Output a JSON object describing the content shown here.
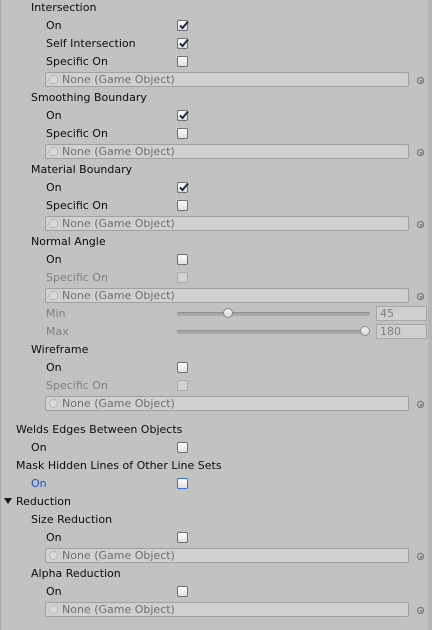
{
  "intersection": {
    "header": "Intersection",
    "on_label": "On",
    "self_label": "Self Intersection",
    "specific_label": "Specific On",
    "field_value": "None (Game Object)",
    "on_checked": true,
    "self_checked": true,
    "specific_checked": false
  },
  "smoothing": {
    "header": "Smoothing Boundary",
    "on_label": "On",
    "specific_label": "Specific On",
    "field_value": "None (Game Object)",
    "on_checked": true,
    "specific_checked": false
  },
  "material": {
    "header": "Material Boundary",
    "on_label": "On",
    "specific_label": "Specific On",
    "field_value": "None (Game Object)",
    "on_checked": true,
    "specific_checked": false
  },
  "normal_angle": {
    "header": "Normal Angle",
    "on_label": "On",
    "specific_label": "Specific On",
    "field_value": "None (Game Object)",
    "min_label": "Min",
    "min_value": "45",
    "max_label": "Max",
    "max_value": "180",
    "on_checked": false,
    "specific_checked": false,
    "min_slider_fraction": 0.25,
    "max_slider_fraction": 1.0
  },
  "wireframe": {
    "header": "Wireframe",
    "on_label": "On",
    "specific_label": "Specific On",
    "field_value": "None (Game Object)",
    "on_checked": false,
    "specific_checked": false
  },
  "welds": {
    "header": "Welds Edges Between Objects",
    "on_label": "On",
    "on_checked": false
  },
  "mask_hidden": {
    "header": "Mask Hidden Lines of Other Line Sets",
    "on_label": "On",
    "on_checked": false
  },
  "reduction": {
    "header": "Reduction",
    "expanded": true,
    "size": {
      "header": "Size Reduction",
      "on_label": "On",
      "field_value": "None (Game Object)",
      "on_checked": false
    },
    "alpha": {
      "header": "Alpha Reduction",
      "on_label": "On",
      "field_value": "None (Game Object)",
      "on_checked": false
    }
  },
  "icons": {
    "checkmark": "checkmark-icon",
    "object_field": "gameobject-icon",
    "object_picker": "object-picker-icon",
    "foldout": "foldout-arrow-down-icon"
  },
  "colors": {
    "background": "#c2c2c2",
    "focus_label": "#1f4fd8",
    "disabled_text": "#7f7f7f"
  }
}
